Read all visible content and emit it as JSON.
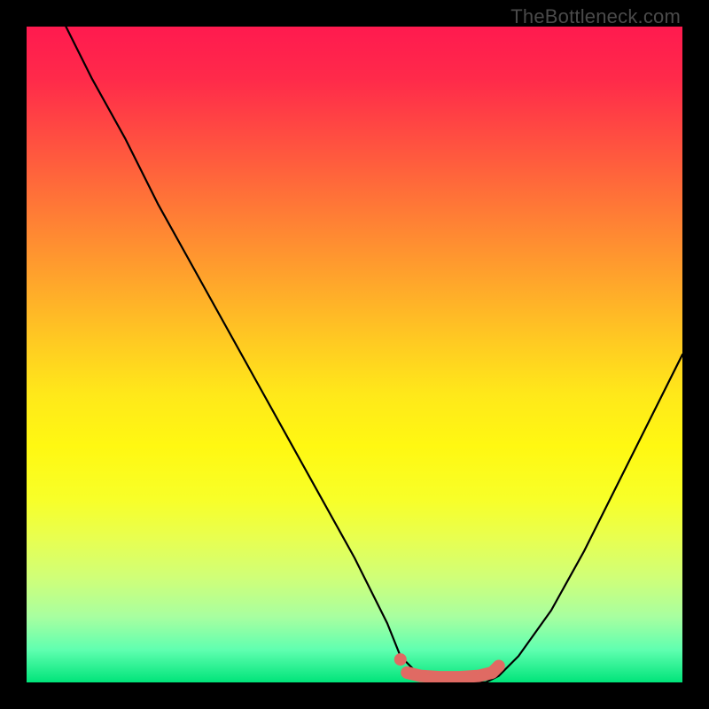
{
  "watermark": "TheBottleneck.com",
  "chart_data": {
    "type": "line",
    "title": "",
    "xlabel": "",
    "ylabel": "",
    "xlim": [
      0,
      100
    ],
    "ylim": [
      0,
      100
    ],
    "series": [
      {
        "name": "curve-black",
        "color": "#000000",
        "x": [
          6,
          10,
          15,
          20,
          25,
          30,
          35,
          40,
          45,
          50,
          55,
          57,
          60,
          65,
          70,
          72,
          75,
          80,
          85,
          90,
          95,
          100
        ],
        "values": [
          100,
          92,
          83,
          73,
          64,
          55,
          46,
          37,
          28,
          19,
          9,
          4,
          1,
          0,
          0,
          1,
          4,
          11,
          20,
          30,
          40,
          50
        ]
      },
      {
        "name": "marker-dot",
        "color": "#e06a63",
        "type": "scatter",
        "x": [
          57
        ],
        "values": [
          3.5
        ]
      },
      {
        "name": "highlight-band",
        "color": "#e06a63",
        "type": "line",
        "x": [
          58,
          60,
          63,
          66,
          69,
          71,
          72
        ],
        "values": [
          1.5,
          1,
          0.8,
          0.8,
          1,
          1.5,
          2.5
        ]
      }
    ],
    "gradient_stops": [
      {
        "pos": 0,
        "color": "#ff1a4f"
      },
      {
        "pos": 50,
        "color": "#ffe81a"
      },
      {
        "pos": 100,
        "color": "#00e47a"
      }
    ]
  }
}
